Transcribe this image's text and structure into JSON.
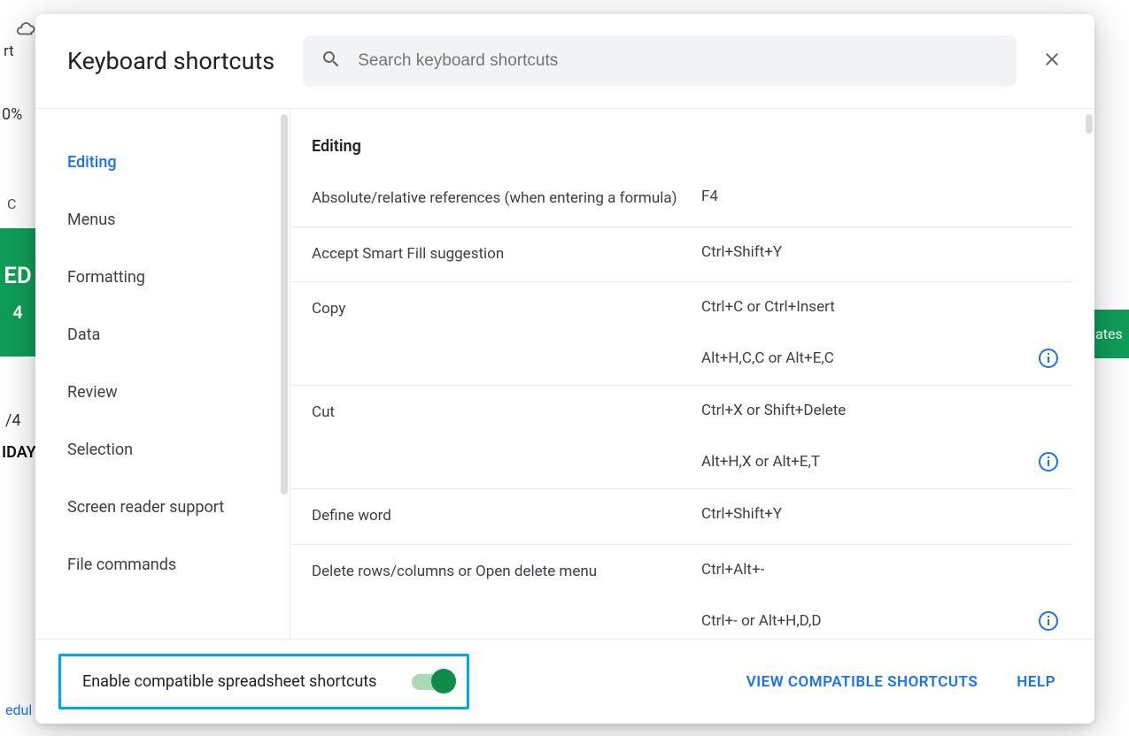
{
  "background": {
    "rt": "rt",
    "zoom": "0%",
    "c": "C",
    "green_top": "ED",
    "green_bot": "4",
    "green_right": "ates",
    "date": "/4",
    "day": "IDAY",
    "edul": "edul"
  },
  "dialog": {
    "title": "Keyboard shortcuts",
    "search_placeholder": "Search keyboard shortcuts"
  },
  "sidebar": {
    "items": [
      {
        "label": "Editing",
        "active": true
      },
      {
        "label": "Menus",
        "active": false
      },
      {
        "label": "Formatting",
        "active": false
      },
      {
        "label": "Data",
        "active": false
      },
      {
        "label": "Review",
        "active": false
      },
      {
        "label": "Selection",
        "active": false
      },
      {
        "label": "Screen reader support",
        "active": false
      },
      {
        "label": "File commands",
        "active": false
      }
    ]
  },
  "content": {
    "section_title": "Editing",
    "shortcuts": [
      {
        "desc": "Absolute/relative references (when entering a formula)",
        "keys": [
          {
            "text": "F4",
            "info": false
          }
        ]
      },
      {
        "desc": "Accept Smart Fill suggestion",
        "keys": [
          {
            "text": "Ctrl+Shift+Y",
            "info": false
          }
        ]
      },
      {
        "desc": "Copy",
        "keys": [
          {
            "text": "Ctrl+C or Ctrl+Insert",
            "info": false
          },
          {
            "text": "Alt+H,C,C or Alt+E,C",
            "info": true
          }
        ]
      },
      {
        "desc": "Cut",
        "keys": [
          {
            "text": "Ctrl+X or Shift+Delete",
            "info": false
          },
          {
            "text": "Alt+H,X or Alt+E,T",
            "info": true
          }
        ]
      },
      {
        "desc": "Define word",
        "keys": [
          {
            "text": "Ctrl+Shift+Y",
            "info": false
          }
        ]
      },
      {
        "desc": "Delete rows/columns or Open delete menu",
        "keys": [
          {
            "text": "Ctrl+Alt+-",
            "info": false
          },
          {
            "text": "Ctrl+- or Alt+H,D,D",
            "info": true
          }
        ]
      }
    ]
  },
  "footer": {
    "toggle_label": "Enable compatible spreadsheet shortcuts",
    "toggle_on": true,
    "view_link": "VIEW COMPATIBLE SHORTCUTS",
    "help_link": "HELP"
  }
}
